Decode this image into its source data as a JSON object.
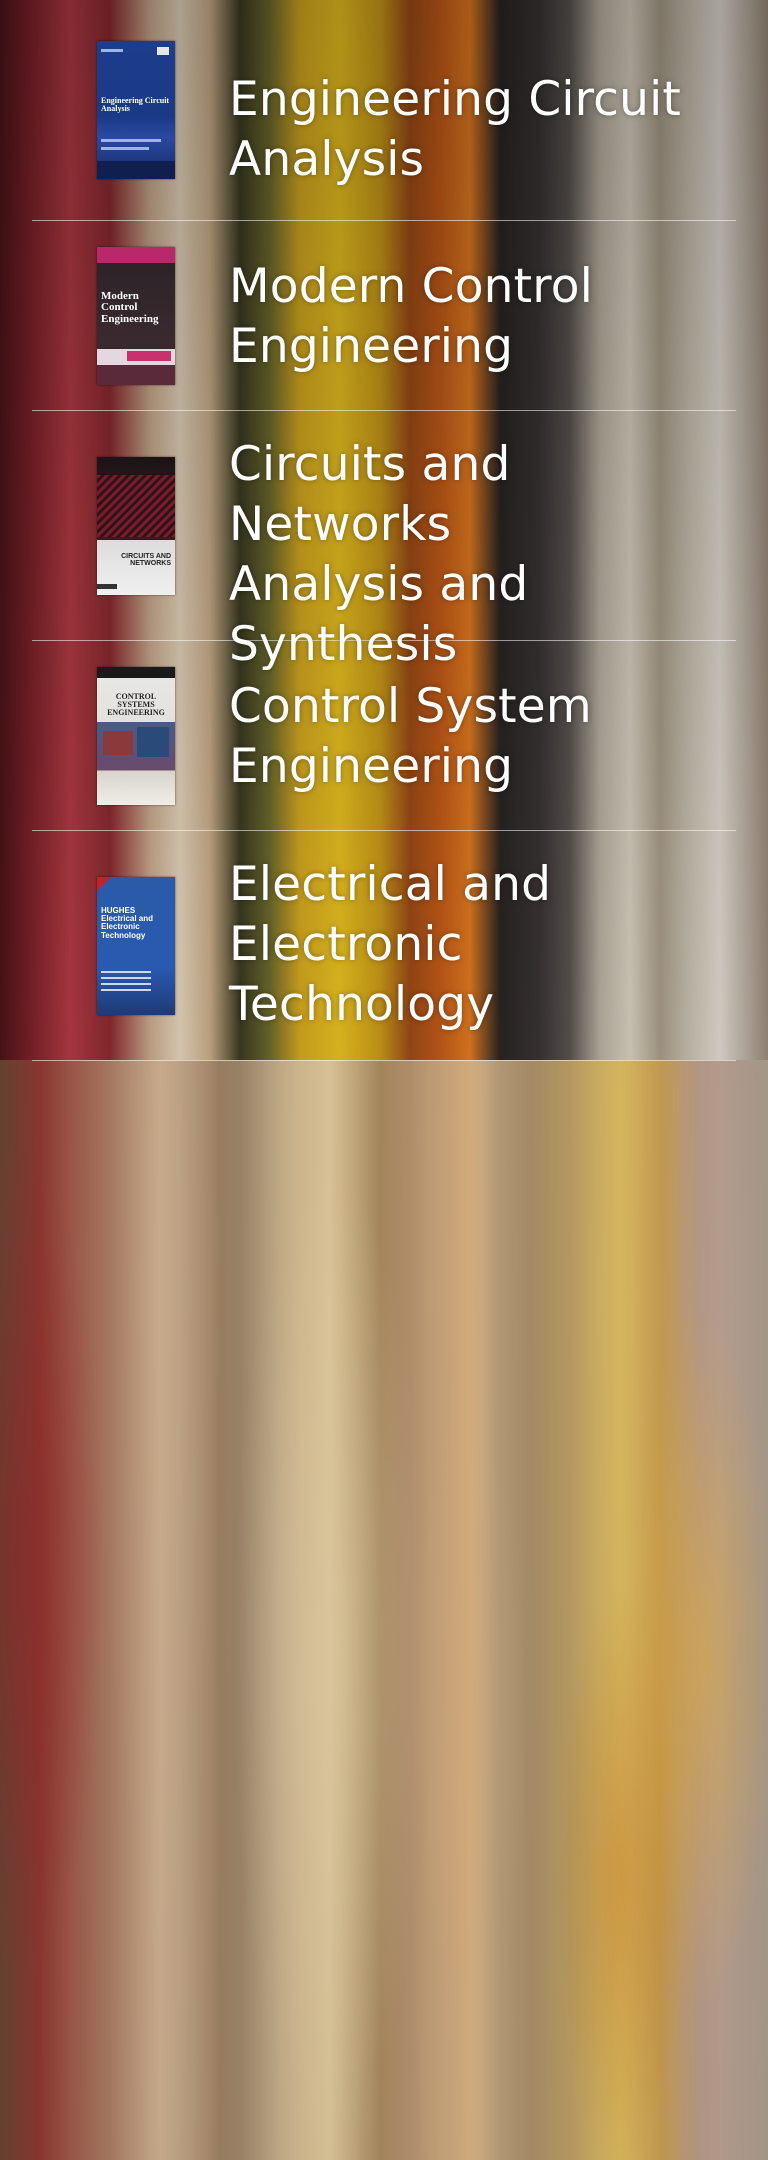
{
  "books": [
    {
      "title": "Engineering Circuit\nAnalysis",
      "cover_icon": "book-cover-engineering-circuit-analysis",
      "cover_text": "Engineering Circuit Analysis",
      "cover_color": "#1d3d8c"
    },
    {
      "title": "Modern Control\nEngineering",
      "cover_icon": "book-cover-modern-control-engineering",
      "cover_text": "Modern Control Engineering",
      "cover_color": "#2a2226"
    },
    {
      "title": "Circuits and Networks\nAnalysis and\nSynthesis",
      "cover_icon": "book-cover-circuits-and-networks",
      "cover_text": "CIRCUITS AND NETWORKS",
      "cover_color": "#3a1a20"
    },
    {
      "title": "Control System\nEngineering",
      "cover_icon": "book-cover-control-system-engineering",
      "cover_text": "CONTROL SYSTEMS ENGINEERING",
      "cover_color": "#e8e6e2"
    },
    {
      "title": "Electrical and\nElectronic\nTechnology",
      "cover_icon": "book-cover-electrical-and-electronic-technology",
      "cover_text": "HUGHES Electrical and Electronic Technology",
      "cover_color": "#2a5aa8"
    }
  ],
  "colors": {
    "text": "#ffffff",
    "divider": "rgba(255,255,255,0.55)"
  }
}
